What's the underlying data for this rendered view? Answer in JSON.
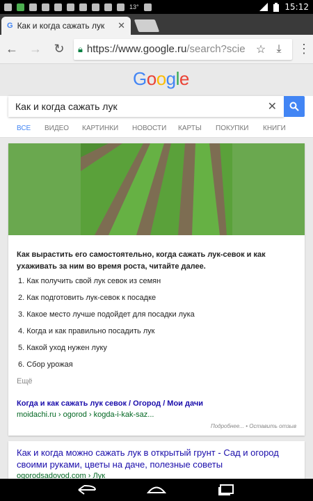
{
  "status_bar": {
    "temperature": "13°",
    "time": "15:12",
    "icons": [
      "notification-icon",
      "app-icon",
      "image-icon",
      "mail-icon",
      "phone-icon",
      "bus-icon",
      "skype-icon",
      "messenger-icon",
      "envelope-icon",
      "weather-icon",
      "cup-icon",
      "signal-icon",
      "battery-icon"
    ]
  },
  "browser": {
    "tab_title": "Как и когда сажать лук",
    "tab_favicon": "G",
    "url_host": "https://www.google.ru",
    "url_path": "/search?scie"
  },
  "google": {
    "logo": "Google",
    "query": "Как и когда сажать лук",
    "tabs": [
      "ВСЕ",
      "ВИДЕО",
      "КАРТИНКИ",
      "НОВОСТИ",
      "КАРТЫ",
      "ПОКУПКИ",
      "КНИГИ"
    ],
    "logo_colors": [
      "#4285F4",
      "#EA4335",
      "#FBBC05",
      "#4285F4",
      "#34A853",
      "#EA4335"
    ]
  },
  "featured": {
    "intro": "Как вырастить его самостоятельно, когда сажать лук-севок и как ухаживать за ним во время роста, читайте далее.",
    "steps": [
      "1. Как получить свой лук севок из семян",
      "2. Как подготовить лук-севок к посадке",
      "3. Какое место лучше подойдет для посадки лука",
      "4. Когда и как правильно посадить лук",
      "5. Какой уход нужен луку",
      "6. Сбор урожая"
    ],
    "more": "Ещё",
    "link_title": "Когда и как сажать лук севок / Огород / Мои дачи",
    "link_url": "moidachi.ru › ogorod › kogda-i-kak-saz...",
    "feedback": "Подробнее... • Оставить отзыв"
  },
  "result2": {
    "title": "Как и когда можно сажать лук в открытый грунт - Сад и огород своими руками, цветы на даче, полезные советы",
    "url": "ogorodsadovod.com › Лук"
  }
}
